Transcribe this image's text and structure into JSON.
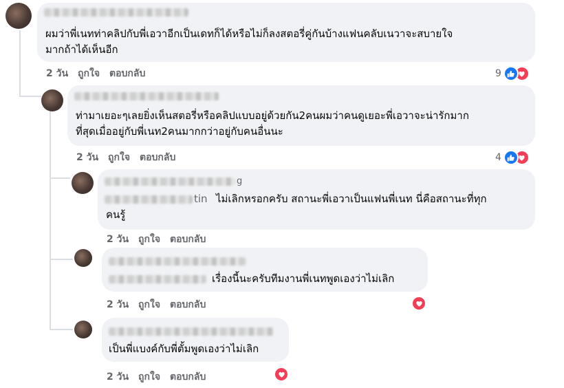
{
  "comments": [
    {
      "text_lines": [
        "ผมว่าพี่เนทท่าคลิปกับพี่เอวาอีกเป็นเดทก็ได้หรือไม่ก็ลงสตอรี่คู่กันบ้างแฟนคลับเนวาจะสบายใจ",
        "มากถ้าได้เห็นอีก"
      ],
      "time": "2 วัน",
      "like_label": "ถูกใจ",
      "reply_label": "ตอบกลับ",
      "reaction_count": "9"
    },
    {
      "text_lines": [
        "ท่ามาเยอะๆเลยยิ่งเห็นสตอรี่หรือคลิปแบบอยู่ด้วยกัน2คนผมว่าคนดูเยอะพี่เอวาจะน่ารักมาก",
        "ที่สุดเมื่ออยู่กับพี่เนท2คนมากกว่าอยู่กับคนอื่นนะ"
      ],
      "time": "2 วัน",
      "like_label": "ถูกใจ",
      "reply_label": "ตอบกลับ",
      "reaction_count": "4"
    },
    {
      "name_tail": "g",
      "tag_tail": "tin",
      "text_line1": "ไม่เลิกหรอกครับ สถานะพี่เอวาเป็นแฟนพี่เนท นี่คือสถานะที่ทุก",
      "text_line2": "คนรู้",
      "time": "2 วัน",
      "like_label": "ถูกใจ",
      "reply_label": "ตอบกลับ"
    },
    {
      "text": "เรื่องนี้นะครับทีมงานพี่เนทพูดเองว่าไม่เลิก",
      "time": "2 วัน",
      "like_label": "ถูกใจ",
      "reply_label": "ตอบกลับ"
    },
    {
      "text": "เป็นพี่แบงค์กับพี่ตั้มพูดเองว่าไม่เลิก",
      "time": "2 วัน",
      "like_label": "ถูกใจ",
      "reply_label": "ตอบกลับ"
    }
  ],
  "colors": {
    "bubble": "#f0f2f5",
    "like": "#1877f2",
    "love": "#f33e58",
    "meta_text": "#65676b"
  },
  "icons": [
    "like-icon",
    "love-icon"
  ]
}
